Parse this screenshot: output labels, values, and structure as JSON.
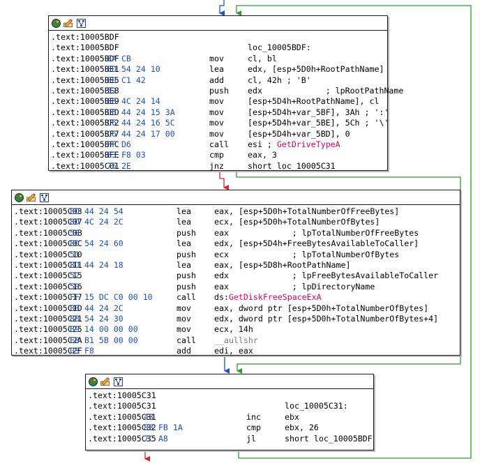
{
  "colors": {
    "true_edge": "#2e9b2e",
    "false_edge": "#e02020",
    "uncond_edge": "#1a4fd6",
    "bytes": "#1f4fc0",
    "api": "#e0006a"
  },
  "icons": [
    "palette-icon",
    "rename-icon",
    "graph-icon"
  ],
  "block1": {
    "lines": [
      {
        "addr": ".text:10005BDF",
        "bytes": "",
        "mn": "",
        "op": ""
      },
      {
        "addr": ".text:10005BDF",
        "bytes": "",
        "mn": "",
        "op": "loc_10005BDF:"
      },
      {
        "addr": ".text:10005BDF",
        "bytes": "8A CB",
        "mn": "mov",
        "op": "cl, bl"
      },
      {
        "addr": ".text:10005BE1",
        "bytes": "8D 54 24 10",
        "mn": "lea",
        "op": "edx, [esp+5D0h+RootPathName]"
      },
      {
        "addr": ".text:10005BE5",
        "bytes": "80 C1 42",
        "mn": "add",
        "op": "cl, 42h ; 'B'"
      },
      {
        "addr": ".text:10005BE8",
        "bytes": "52",
        "mn": "push",
        "op": "edx             ; lpRootPathName"
      },
      {
        "addr": ".text:10005BE9",
        "bytes": "88 4C 24 14",
        "mn": "mov",
        "op": "[esp+5D4h+RootPathName], cl"
      },
      {
        "addr": ".text:10005BED",
        "bytes": "C6 44 24 15 3A",
        "mn": "mov",
        "op": "[esp+5D4h+var_5BF], 3Ah ; ':'"
      },
      {
        "addr": ".text:10005BF2",
        "bytes": "C6 44 24 16 5C",
        "mn": "mov",
        "op": "[esp+5D4h+var_5BE], 5Ch ; '\\'"
      },
      {
        "addr": ".text:10005BF7",
        "bytes": "C6 44 24 17 00",
        "mn": "mov",
        "op": "[esp+5D4h+var_5BD], 0"
      },
      {
        "addr": ".text:10005BFC",
        "bytes": "FF D6",
        "mn": "call",
        "op": "esi ; GetDriveTypeA"
      },
      {
        "addr": ".text:10005BFE",
        "bytes": "83 F8 03",
        "mn": "cmp",
        "op": "eax, 3"
      },
      {
        "addr": ".text:10005C01",
        "bytes": "75 2E",
        "mn": "jnz",
        "op": "short loc_10005C31"
      }
    ]
  },
  "block2": {
    "lines": [
      {
        "addr": ".text:10005C03",
        "bytes": "8D 44 24 54",
        "mn": "lea",
        "op": "eax, [esp+5D0h+TotalNumberOfFreeBytes]"
      },
      {
        "addr": ".text:10005C07",
        "bytes": "8D 4C 24 2C",
        "mn": "lea",
        "op": "ecx, [esp+5D0h+TotalNumberOfBytes]"
      },
      {
        "addr": ".text:10005C0B",
        "bytes": "50",
        "mn": "push",
        "op": "eax             ; lpTotalNumberOfFreeBytes"
      },
      {
        "addr": ".text:10005C0C",
        "bytes": "8D 54 24 60",
        "mn": "lea",
        "op": "edx, [esp+5D4h+FreeBytesAvailableToCaller]"
      },
      {
        "addr": ".text:10005C10",
        "bytes": "51",
        "mn": "push",
        "op": "ecx             ; lpTotalNumberOfBytes"
      },
      {
        "addr": ".text:10005C11",
        "bytes": "8D 44 24 18",
        "mn": "lea",
        "op": "eax, [esp+5D8h+RootPathName]"
      },
      {
        "addr": ".text:10005C15",
        "bytes": "52",
        "mn": "push",
        "op": "edx             ; lpFreeBytesAvailableToCaller"
      },
      {
        "addr": ".text:10005C16",
        "bytes": "50",
        "mn": "push",
        "op": "eax             ; lpDirectoryName"
      },
      {
        "addr": ".text:10005C17",
        "bytes": "FF 15 DC C0 00 10",
        "mn": "call",
        "op": "ds:GetDiskFreeSpaceExA"
      },
      {
        "addr": ".text:10005C1D",
        "bytes": "8B 44 24 2C",
        "mn": "mov",
        "op": "eax, dword ptr [esp+5D0h+TotalNumberOfBytes]"
      },
      {
        "addr": ".text:10005C21",
        "bytes": "8B 54 24 30",
        "mn": "mov",
        "op": "edx, dword ptr [esp+5D0h+TotalNumberOfBytes+4]"
      },
      {
        "addr": ".text:10005C25",
        "bytes": "B9 14 00 00 00",
        "mn": "mov",
        "op": "ecx, 14h"
      },
      {
        "addr": ".text:10005C2A",
        "bytes": "E8 B1 5B 00 00",
        "mn": "call",
        "op": "__aullshr"
      },
      {
        "addr": ".text:10005C2F",
        "bytes": "03 F8",
        "mn": "add",
        "op": "edi, eax"
      }
    ]
  },
  "block3": {
    "lines": [
      {
        "addr": ".text:10005C31",
        "bytes": "",
        "mn": "",
        "op": ""
      },
      {
        "addr": ".text:10005C31",
        "bytes": "",
        "mn": "",
        "op": "loc_10005C31:"
      },
      {
        "addr": ".text:10005C31",
        "bytes": "43",
        "mn": "inc",
        "op": "ebx"
      },
      {
        "addr": ".text:10005C32",
        "bytes": "83 FB 1A",
        "mn": "cmp",
        "op": "ebx, 26"
      },
      {
        "addr": ".text:10005C35",
        "bytes": "7C A8",
        "mn": "jl",
        "op": "short loc_10005BDF"
      }
    ]
  }
}
